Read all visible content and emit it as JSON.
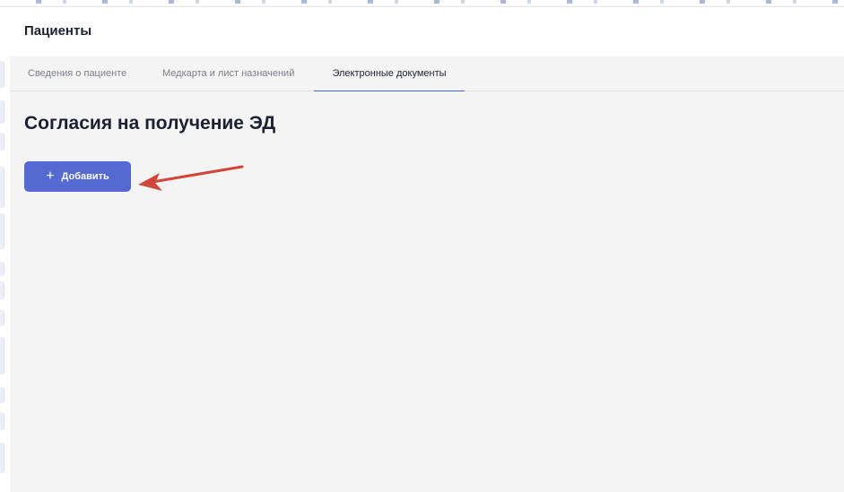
{
  "header": {
    "title": "Пациенты"
  },
  "tabs": [
    {
      "label": "Сведения о пациенте",
      "active": false
    },
    {
      "label": "Медкарта и лист назначений",
      "active": false
    },
    {
      "label": "Электронные документы",
      "active": true
    }
  ],
  "section": {
    "title": "Согласия на получение ЭД",
    "add_button": {
      "icon": "plus-icon",
      "label": "Добавить"
    }
  },
  "annotation": {
    "icon": "arrow-annotation-icon",
    "color": "#d2453a"
  },
  "colors": {
    "accent": "#5469d4",
    "content_background": "#f4f4f4",
    "active_tab_underline": "#4f5fd8"
  }
}
